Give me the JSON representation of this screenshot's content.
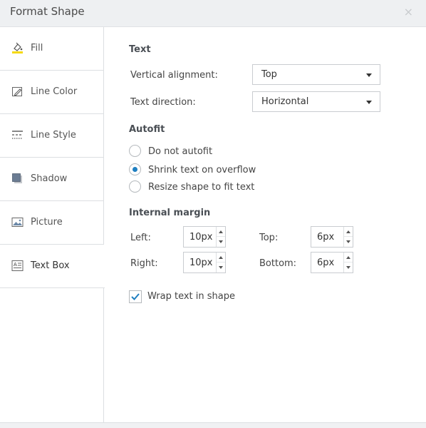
{
  "dialog": {
    "title": "Format Shape",
    "close_glyph": "×"
  },
  "sidebar": {
    "active": "Text Box",
    "items": [
      {
        "label": "Fill",
        "icon": "paint-bucket-icon"
      },
      {
        "label": "Line Color",
        "icon": "pencil-icon"
      },
      {
        "label": "Line Style",
        "icon": "line-style-icon"
      },
      {
        "label": "Shadow",
        "icon": "shadow-icon"
      },
      {
        "label": "Picture",
        "icon": "picture-icon"
      },
      {
        "label": "Text Box",
        "icon": "text-box-icon"
      }
    ]
  },
  "text": {
    "heading": "Text",
    "vertical_alignment_label": "Vertical alignment:",
    "vertical_alignment_value": "Top",
    "text_direction_label": "Text direction:",
    "text_direction_value": "Horizontal"
  },
  "autofit": {
    "heading": "Autofit",
    "options": [
      {
        "label": "Do not autofit",
        "checked": false
      },
      {
        "label": "Shrink text on overflow",
        "checked": true
      },
      {
        "label": "Resize shape to fit text",
        "checked": false
      }
    ]
  },
  "margin": {
    "heading": "Internal margin",
    "left_label": "Left:",
    "left_value": "10px",
    "top_label": "Top:",
    "top_value": "6px",
    "right_label": "Right:",
    "right_value": "10px",
    "bottom_label": "Bottom:",
    "bottom_value": "6px"
  },
  "wrap": {
    "label": "Wrap text in shape",
    "checked": true
  },
  "colors": {
    "accent": "#1f7fc1",
    "fill_icon_yellow": "#f5d90a"
  }
}
